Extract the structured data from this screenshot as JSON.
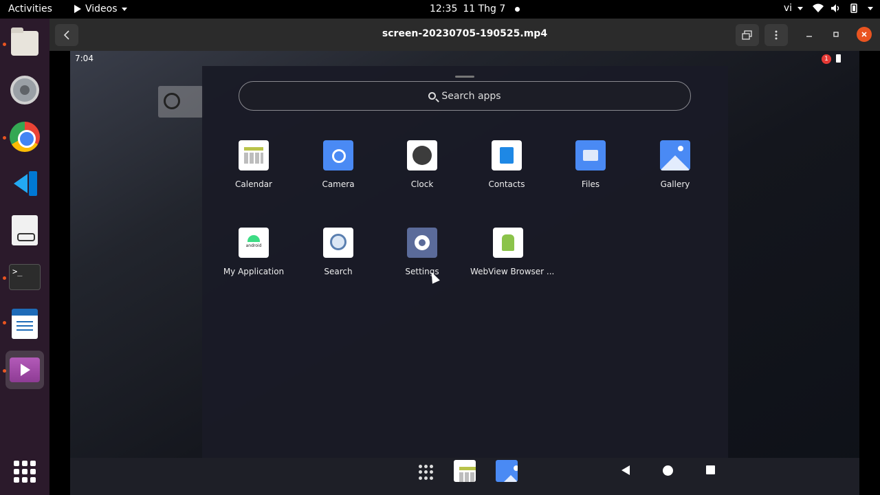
{
  "topbar": {
    "activities": "Activities",
    "app_menu": "Videos",
    "time": "12:35",
    "date": "11 Thg 7",
    "input_lang": "vi"
  },
  "dock": {
    "items": [
      {
        "name": "files",
        "running": true
      },
      {
        "name": "settings",
        "running": false
      },
      {
        "name": "chrome",
        "running": true
      },
      {
        "name": "vscode",
        "running": false
      },
      {
        "name": "document-viewer",
        "running": false
      },
      {
        "name": "terminal",
        "running": true
      },
      {
        "name": "writer",
        "running": true
      },
      {
        "name": "videos",
        "running": true
      }
    ]
  },
  "window": {
    "title": "screen-20230705-190525.mp4"
  },
  "android": {
    "status_time": "7:04",
    "notification_count": "1",
    "search_placeholder": "Search apps",
    "apps": [
      {
        "label": "Calendar",
        "icon": "calendar-icon"
      },
      {
        "label": "Camera",
        "icon": "camera-icon"
      },
      {
        "label": "Clock",
        "icon": "clock-icon"
      },
      {
        "label": "Contacts",
        "icon": "contacts-icon"
      },
      {
        "label": "Files",
        "icon": "files-icon"
      },
      {
        "label": "Gallery",
        "icon": "gallery-icon"
      },
      {
        "label": "My Application",
        "icon": "android-icon"
      },
      {
        "label": "Search",
        "icon": "search-icon"
      },
      {
        "label": "Settings",
        "icon": "settings-gear-icon"
      },
      {
        "label": "WebView Browser ...",
        "icon": "webview-icon"
      }
    ]
  },
  "colors": {
    "accent": "#e95420",
    "drawer_bg": "#1a1b26",
    "dock_bg": "#2b1a2b"
  }
}
